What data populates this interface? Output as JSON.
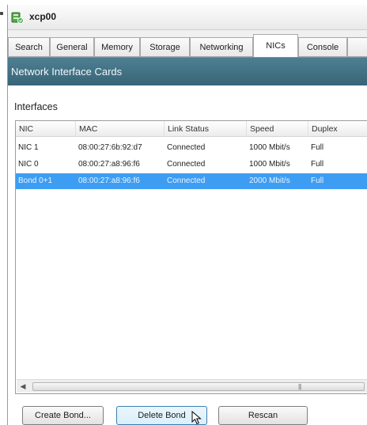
{
  "window": {
    "title": "xcp00",
    "icon": "server-icon",
    "accent": "#386577"
  },
  "tabs": [
    {
      "label": "Search",
      "active": false
    },
    {
      "label": "General",
      "active": false
    },
    {
      "label": "Memory",
      "active": false
    },
    {
      "label": "Storage",
      "active": false
    },
    {
      "label": "Networking",
      "active": false
    },
    {
      "label": "NICs",
      "active": true
    },
    {
      "label": "Console",
      "active": false
    }
  ],
  "section": {
    "title": "Network Interface Cards"
  },
  "interfaces": {
    "label": "Interfaces",
    "columns": [
      "NIC",
      "MAC",
      "Link Status",
      "Speed",
      "Duplex"
    ],
    "rows": [
      {
        "nic": "NIC 1",
        "mac": "08:00:27:6b:92:d7",
        "link": "Connected",
        "speed": "1000 Mbit/s",
        "duplex": "Full",
        "selected": false
      },
      {
        "nic": "NIC 0",
        "mac": "08:00:27:a8:96:f6",
        "link": "Connected",
        "speed": "1000 Mbit/s",
        "duplex": "Full",
        "selected": false
      },
      {
        "nic": "Bond 0+1",
        "mac": "08:00:27:a8:96:f6",
        "link": "Connected",
        "speed": "2000 Mbit/s",
        "duplex": "Full",
        "selected": true
      }
    ],
    "selected_color": "#3d9df3"
  },
  "buttons": {
    "create_bond": "Create Bond...",
    "delete_bond": "Delete Bond",
    "rescan": "Rescan"
  }
}
